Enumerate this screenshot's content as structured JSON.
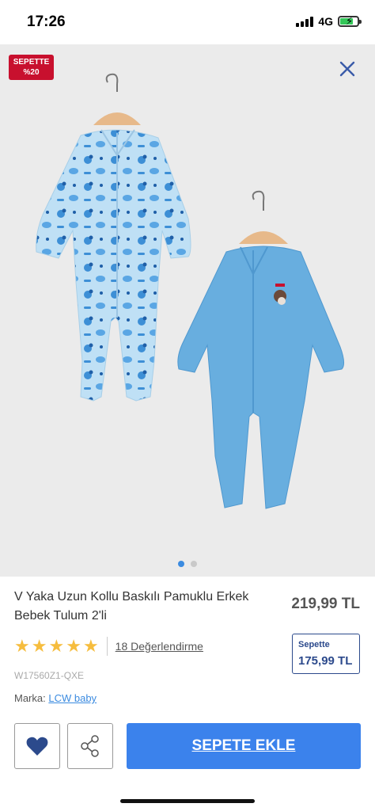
{
  "status": {
    "time": "17:26",
    "network": "4G"
  },
  "gallery": {
    "badge_line1": "SEPETTE",
    "badge_line2": "%20",
    "close_icon": "close-icon",
    "current_image": 1,
    "image_count": 2
  },
  "product": {
    "title": "V Yaka Uzun Kollu Baskılı Pamuklu Erkek Bebek Tulum 2'li",
    "price": "219,99 TL",
    "rating_stars": 5,
    "reviews": "18 Değerlendirme",
    "cart_price_label": "Sepette",
    "cart_price": "175,99 TL",
    "sku": "W17560Z1-QXE",
    "brand_label": "Marka:",
    "brand": "LCW baby"
  },
  "actions": {
    "favorite_icon": "heart-icon",
    "share_icon": "share-icon",
    "add_to_cart": "SEPETE EKLE"
  },
  "colors": {
    "accent": "#3b82ec",
    "badge": "#c8102e",
    "star": "#f6bd3e",
    "cart_box": "#2c4a8c"
  }
}
